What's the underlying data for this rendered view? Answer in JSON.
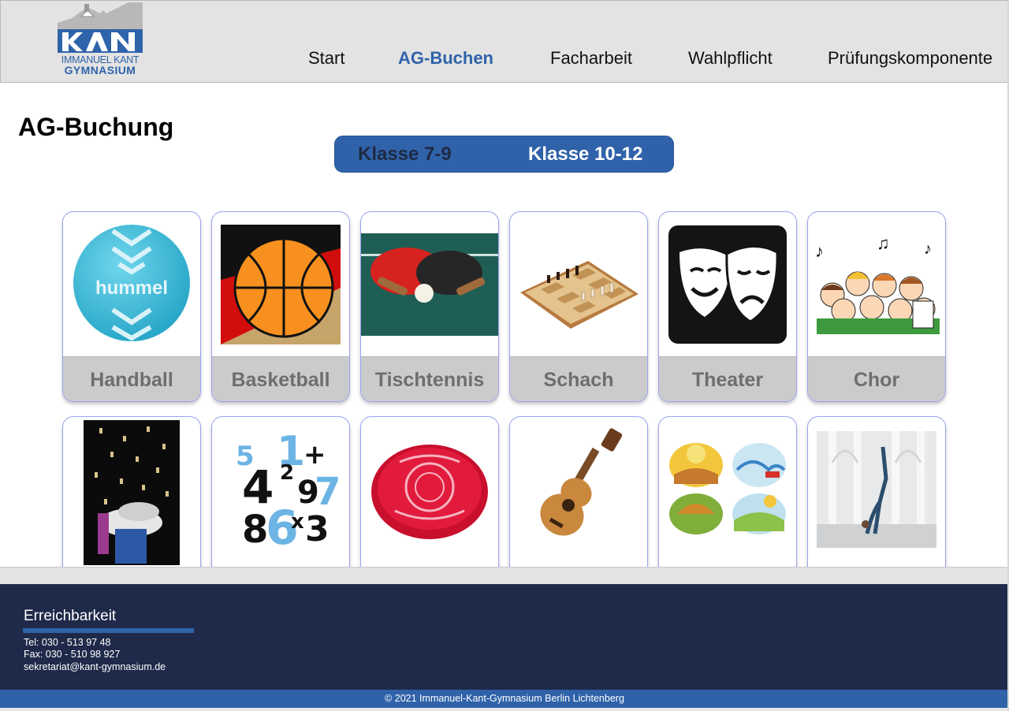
{
  "header": {
    "logo": {
      "line1": "IMMANUEL KANT",
      "line2": "GYMNASIUM"
    },
    "nav": [
      {
        "label": "Start",
        "active": false
      },
      {
        "label": "AG-Buchen",
        "active": true
      },
      {
        "label": "Facharbeit",
        "active": false
      },
      {
        "label": "Wahlpflicht",
        "active": false
      },
      {
        "label": "Prüfungskomponente",
        "active": false
      }
    ]
  },
  "main": {
    "title": "AG-Buchung",
    "toggle": {
      "option1": "Klasse 7-9",
      "option2": "Klasse 10-12",
      "selected": "Klasse 10-12"
    },
    "cards_row1": [
      "Handball",
      "Basketball",
      "Tischtennis",
      "Schach",
      "Theater",
      "Chor"
    ],
    "cards_row2_icons": [
      "science-experiment-image",
      "numbers-image",
      "frisbee-image",
      "guitar-image",
      "seasons-image",
      "yoga-image"
    ]
  },
  "footer": {
    "heading": "Erreichbarkeit",
    "tel": "Tel:  030 - 513 97 48",
    "fax": "Fax: 030 - 510 98 927",
    "email": "sekretariat@kant-gymnasium.de",
    "copyright": "© 2021 Immanuel-Kant-Gymnasium Berlin Lichtenberg"
  },
  "colors": {
    "brand_blue": "#2f62a9",
    "footer_navy": "#1f2a4a",
    "header_gray": "#e3e3e3",
    "card_label_gray": "#cbcbcb"
  }
}
